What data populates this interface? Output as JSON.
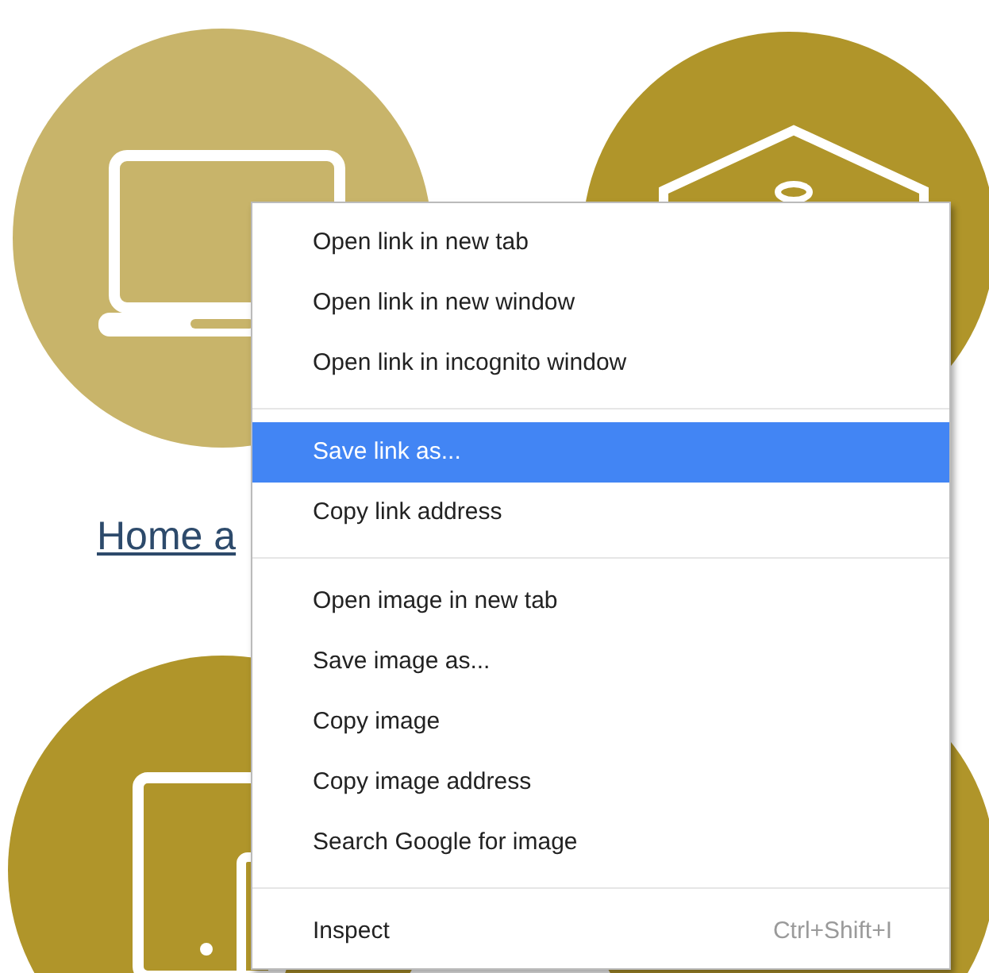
{
  "page": {
    "link": "Home a"
  },
  "context_menu": {
    "sections": [
      {
        "items": [
          {
            "label": "Open link in new tab",
            "selected": false
          },
          {
            "label": "Open link in new window",
            "selected": false
          },
          {
            "label": "Open link in incognito window",
            "selected": false
          }
        ]
      },
      {
        "items": [
          {
            "label": "Save link as...",
            "selected": true
          },
          {
            "label": "Copy link address",
            "selected": false
          }
        ]
      },
      {
        "items": [
          {
            "label": "Open image in new tab",
            "selected": false
          },
          {
            "label": "Save image as...",
            "selected": false
          },
          {
            "label": "Copy image",
            "selected": false
          },
          {
            "label": "Copy image address",
            "selected": false
          },
          {
            "label": "Search Google for image",
            "selected": false
          }
        ]
      },
      {
        "items": [
          {
            "label": "Inspect",
            "selected": false,
            "shortcut": "Ctrl+Shift+I"
          }
        ]
      }
    ]
  }
}
